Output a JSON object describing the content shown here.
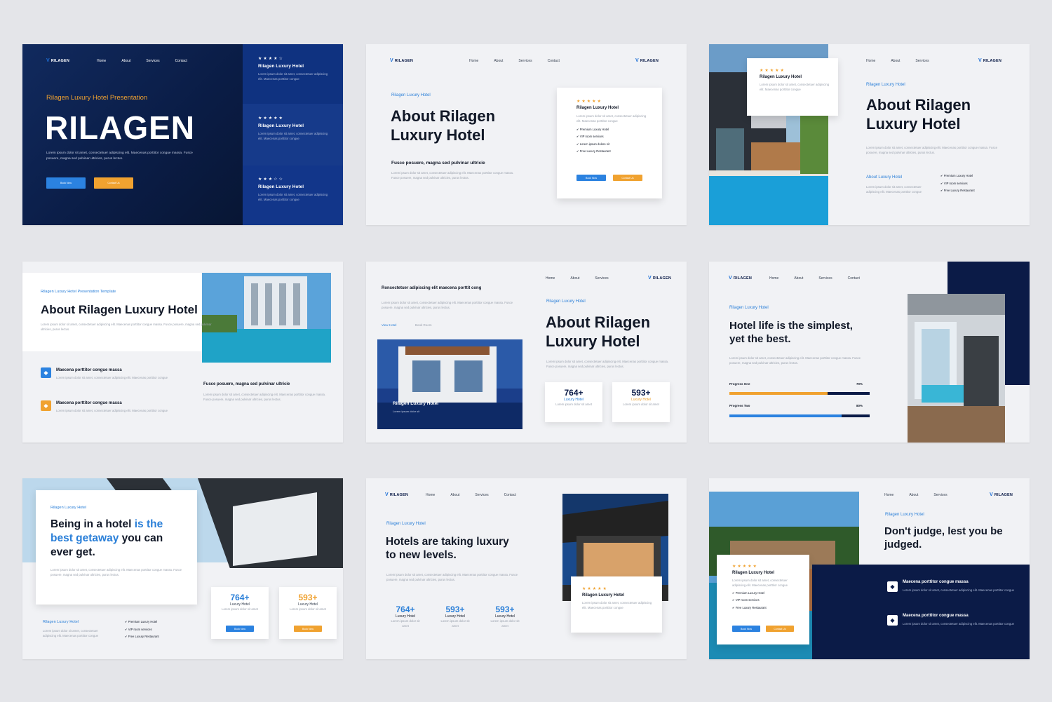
{
  "nav": {
    "home": "Home",
    "about": "About",
    "services": "Services",
    "contact": "Contact",
    "brand": "RILAGEN"
  },
  "lorem": {
    "a": "Lorem ipsum dolor sit amet, consectetuer adipiscing elit. Maecenas porttitor congue massa. Fusce posuere, magna sed pulvinar ultricies, purus lectus.",
    "b": "Lorem ipsum dolor sit amet, consectetuer adipiscing elit. Maecenas porttitor congue",
    "c": "Lorem ipsum dolor sit amet"
  },
  "s1": {
    "eyebrow": "Rilagen Luxury Hotel Presentation",
    "title": "RILAGEN",
    "btn1": "Book Now",
    "btn2": "Contact Us",
    "cards": [
      {
        "stars": "★★★★☆",
        "title": "Rilagen Luxury Hotel"
      },
      {
        "stars": "★★★★★",
        "title": "Rilagen Luxury Hotel"
      },
      {
        "stars": "★★★☆☆",
        "title": "Rilagen Luxury Hotel"
      }
    ]
  },
  "s2": {
    "eyebrow": "Rilagen Luxury Hotel",
    "title1": "About Rilagen",
    "title2": "Luxury Hotel",
    "sub": "Fusce posuere, magna sed pulvinar ultricie",
    "stars": "★★★★★",
    "card_title": "Rilagen Luxury Hotel",
    "checks": [
      "Premium Luxury Hotel",
      "VIP room services",
      "Lorem ipsum dolore sit",
      "Free Luxury Restaurant"
    ],
    "btn1": "Book Now",
    "btn2": "Contact Us"
  },
  "s3": {
    "eyebrow": "Rilagen Luxury Hotel",
    "title1": "About Rilagen",
    "title2": "Luxury Hotel",
    "stars": "★★★★★",
    "card_title": "Rilagen Luxury Hotel",
    "sub": "About Luxury Hotel",
    "checks": [
      "Premium Luxury Hotel",
      "VIP room services",
      "Free Luxury Restaurant"
    ]
  },
  "s4": {
    "eyebrow": "Rilagen Luxury Hotel Presentation Template",
    "title": "About Rilagen Luxury Hotel",
    "item1": "Maecena porttitor congue massa",
    "item2": "Maecena porttitor congue massa",
    "sub": "Fusce posuere, magna sed pulvinar ultricie"
  },
  "s5": {
    "top": "Ronsectetuer adipiscing elit maecena porttit cong",
    "link1": "View Hotel",
    "link2": "Book Room",
    "eyebrow": "Rilagen Luxury Hotel",
    "title1": "About Rilagen",
    "title2": "Luxury Hotel",
    "img_title": "Rilagen Luxury Hotel",
    "img_sub": "Lorem ipsum dolor sit",
    "stat1": "764+",
    "stat1_label": "Luxury Hotel",
    "stat2": "593+",
    "stat2_label": "Luxury Hotel"
  },
  "s6": {
    "eyebrow": "Rilagen Luxury Hotel",
    "title1": "Hotel life is the simplest,",
    "title2": "yet the best.",
    "p1_label": "Progress One",
    "p1": 0.7,
    "p1_text": "70%",
    "p2_label": "Progress Two",
    "p2": 0.8,
    "p2_text": "80%"
  },
  "s7": {
    "eyebrow": "Rilagen Luxury Hotel",
    "t1": "Being in a hotel",
    "t1b": " is the",
    "t2": "best getaway",
    "t2b": " you can",
    "t3": "ever get.",
    "sub": "Rilagen Luxury Hotel",
    "checks": [
      "Premium Luxury Hotel",
      "VIP room services",
      "Free Luxury Restaurant"
    ],
    "stat1": "764+",
    "stat1_label": "Luxury Hotel",
    "stat2": "593+",
    "stat2_label": "Luxury Hotel",
    "btn1": "Book Now",
    "btn2": "Book Now"
  },
  "s8": {
    "eyebrow": "Rilagen Luxury Hotel",
    "title1": "Hotels are taking luxury",
    "title2": "to new levels.",
    "stats": [
      {
        "n": "764+",
        "l": "Luxury Hotel"
      },
      {
        "n": "593+",
        "l": "Luxury Hotel"
      },
      {
        "n": "593+",
        "l": "Luxury Hotel"
      }
    ],
    "stars": "★★★★★",
    "card_title": "Rilagen Luxury Hotel"
  },
  "s9": {
    "eyebrow": "Rilagen Luxury Hotel",
    "title1": "Don't judge, lest you be",
    "title2": "judged.",
    "stars": "★★★★★",
    "card_title": "Rilagen Luxury Hotel",
    "checks": [
      "Premium Luxury Hotel",
      "VIP room services",
      "Free Luxury Restaurant"
    ],
    "item1": "Maecena porttitor congue massa",
    "item2": "Maecena porttitor congue massa",
    "btn1": "Book Now",
    "btn2": "Contact Us"
  },
  "colors": {
    "navy": "#0b1b47",
    "blue": "#2b82e0",
    "orange": "#f0a230",
    "bg": "#f1f2f5"
  }
}
